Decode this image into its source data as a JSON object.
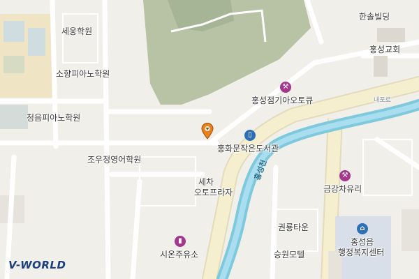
{
  "map": {
    "labels": {
      "sewoong": "세웅학원",
      "sohyang": "소향피아노학원",
      "cheongeum": "청음피아노학원",
      "jowoo": "조우정영어학원",
      "hansol": "한솔빌딩",
      "hongseong_church": "홍성교회",
      "hongseong_repair": "홍성점기아오토큐",
      "library": "홍화문작은도서관",
      "carwash_line1": "세차",
      "carwash_line2": "오토프라자",
      "geumgang": "금강차유리",
      "gwonryong": "권룡타운",
      "seungwon": "승원모텔",
      "sion_gas": "시온주유소",
      "welfare_line1": "홍성읍",
      "welfare_line2": "행정복지센터",
      "road_name": "내포로",
      "river_name": "홍성천"
    },
    "colors": {
      "background": "#f1efe9",
      "green_area": "#b7c3a4",
      "river": "#7fc9dc",
      "main_road": "#f5efd0",
      "block_outline": "#ffffff",
      "poi_magenta": "#a3368d",
      "poi_blue": "#2d6fb7",
      "marker": "#e8821f"
    },
    "icons": [
      "wrench-icon",
      "book-icon",
      "wrench-icon",
      "fuel-icon",
      "government-icon",
      "location-pin-icon"
    ]
  },
  "branding": {
    "logo_text": "V-WORLD"
  }
}
